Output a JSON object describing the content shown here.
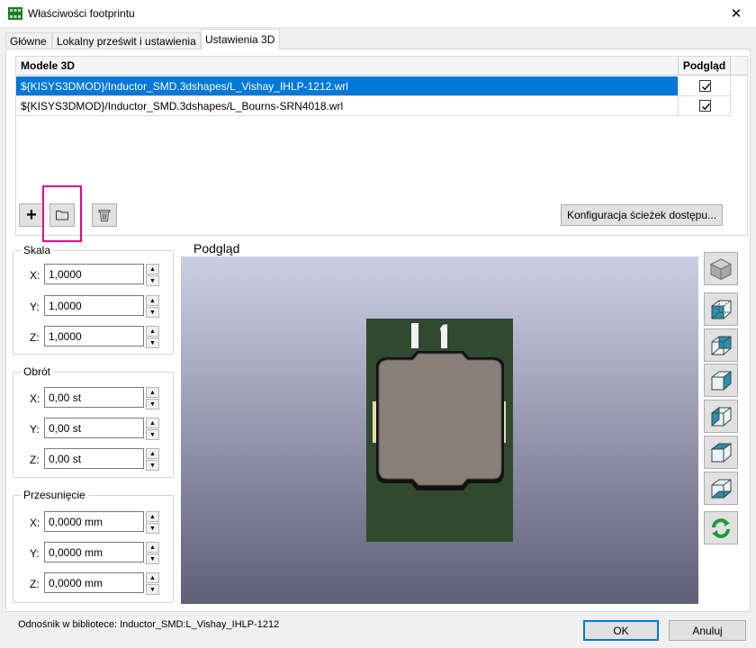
{
  "window": {
    "title": "Właściwości footprintu",
    "close_glyph": "✕",
    "app_icon": "footprint-app-icon"
  },
  "tabs": [
    {
      "label": "Główne",
      "active": false
    },
    {
      "label": "Lokalny prześwit i ustawienia",
      "active": false
    },
    {
      "label": "Ustawienia 3D",
      "active": true
    }
  ],
  "models": {
    "header_model": "Modele 3D",
    "header_preview": "Podgląd",
    "rows": [
      {
        "path": "${KISYS3DMOD}/Inductor_SMD.3dshapes/L_Vishay_IHLP-1212.wrl",
        "preview": true,
        "selected": true
      },
      {
        "path": "${KISYS3DMOD}/Inductor_SMD.3dshapes/L_Bourns-SRN4018.wrl",
        "preview": true,
        "selected": false
      }
    ],
    "add_glyph": "+",
    "config_label": "Konfiguracja ścieżek dostępu..."
  },
  "scale": {
    "title": "Skala",
    "x_label": "X:",
    "x": "1,0000",
    "y_label": "Y:",
    "y": "1,0000",
    "z_label": "Z:",
    "z": "1,0000"
  },
  "rotation": {
    "title": "Obrót",
    "x_label": "X:",
    "x": "0,00 st",
    "y_label": "Y:",
    "y": "0,00 st",
    "z_label": "Z:",
    "z": "0,00 st"
  },
  "offset": {
    "title": "Przesunięcie",
    "x_label": "X:",
    "x": "0,0000 mm",
    "y_label": "Y:",
    "y": "0,0000 mm",
    "z_label": "Z:",
    "z": "0,0000 mm"
  },
  "preview": {
    "label": "Podgląd",
    "board_color": "#2f4a30",
    "body_color": "#888078",
    "silk_text": "L1"
  },
  "view_buttons": [
    "view-3d-icon",
    "view-front-icon",
    "view-back-icon",
    "view-left-icon",
    "view-right-icon",
    "view-top-icon",
    "view-bottom-icon",
    "reload-icon"
  ],
  "footer": {
    "library_ref": "Odnośnik w bibliotece: Inductor_SMD:L_Vishay_IHLP-1212",
    "ok": "OK",
    "cancel": "Anuluj"
  },
  "colors": {
    "selection": "#0078d7",
    "highlight": "#e8008a"
  }
}
